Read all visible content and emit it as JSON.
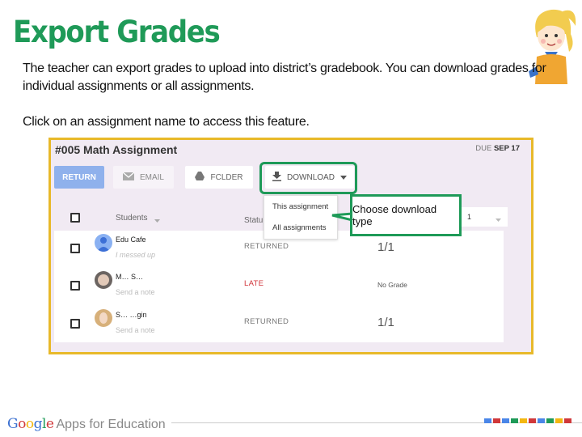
{
  "slide": {
    "title": "Export Grades",
    "paragraph1": "The teacher can export grades to upload into district’s gradebook. You can download grades for individual assignments or all assignments.",
    "paragraph2": "Click on an assignment name to access this feature."
  },
  "screenshot": {
    "assignment_title": "#005 Math Assignment",
    "due_label": "DUE",
    "due_date": "SEP 17",
    "toolbar": {
      "return_label": "RETURN",
      "email_label": "EMAIL",
      "folder_label": "FCLDER",
      "download_label": "DOWNLOAD"
    },
    "download_menu": [
      "This assignment",
      "All assignments"
    ],
    "table": {
      "students_header": "Students",
      "status_header": "Statu",
      "points_value": "1"
    },
    "rows": [
      {
        "name": "Edu Cafe",
        "note": "I messed up",
        "status": "RETURNED",
        "grade": "1/1"
      },
      {
        "name": "M… S…",
        "note": "Send a note",
        "status": "LATE",
        "grade": "No Grade"
      },
      {
        "name": "S… …gin",
        "note": "Send a note",
        "status": "RETURNED",
        "grade": "1/1"
      }
    ]
  },
  "callout": {
    "text": "Choose download type"
  },
  "footer": {
    "brand": "Google",
    "product": "Apps for Education",
    "square_colors": [
      "#4a86e8",
      "#d0383a",
      "#4a86e8",
      "#1e9a58",
      "#f3b712",
      "#d0383a",
      "#4a86e8",
      "#1e9a58",
      "#f3b712",
      "#d0383a"
    ]
  },
  "colors": {
    "title_green": "#1f9a58",
    "frame_yellow": "#e8b92a",
    "callout_green": "#1e9a58",
    "late_red": "#d0343a"
  }
}
